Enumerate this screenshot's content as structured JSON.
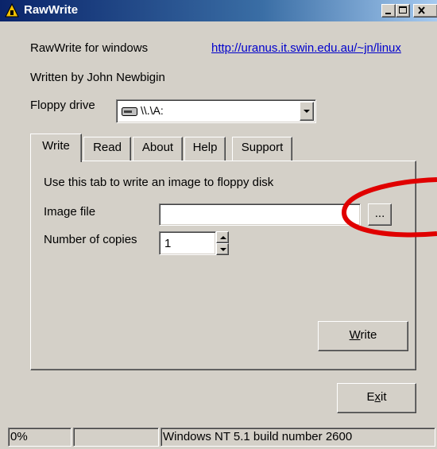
{
  "window": {
    "title": "RawWrite",
    "app_name": "RawWrite for windows",
    "url": "http://uranus.it.swin.edu.au/~jn/linux",
    "author": "Written by John Newbigin",
    "accent_color": "#0a246a"
  },
  "floppy": {
    "label": "Floppy drive",
    "selected": "\\\\.\\A:"
  },
  "tabs": [
    {
      "label": "Write"
    },
    {
      "label": "Read"
    },
    {
      "label": "About"
    },
    {
      "label": "Help"
    },
    {
      "label": "Support"
    }
  ],
  "write_tab": {
    "description": "Use this tab to write an image to floppy disk",
    "image_file_label": "Image file",
    "image_file_value": "",
    "browse_label": "...",
    "copies_label": "Number of copies",
    "copies_value": "1",
    "write_button": {
      "mnemonic": "W",
      "rest": "rite"
    }
  },
  "exit_button": {
    "pre": "E",
    "mnemonic": "x",
    "rest": "it"
  },
  "status": {
    "progress": "0%",
    "middle": "",
    "os": "Windows NT 5.1 build number 2600"
  },
  "annotation": {
    "type": "red-ellipse",
    "color": "#e00000"
  }
}
